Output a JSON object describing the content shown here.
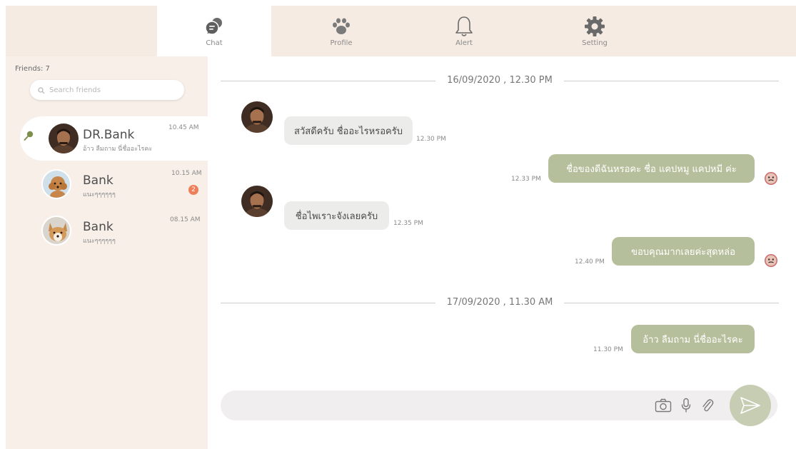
{
  "nav": {
    "tabs": [
      {
        "label": "Chat",
        "icon": "chat-bubbles-icon",
        "active": true
      },
      {
        "label": "Profile",
        "icon": "paw-icon",
        "active": false
      },
      {
        "label": "Alert",
        "icon": "bell-icon",
        "active": false
      },
      {
        "label": "Setting",
        "icon": "gear-icon",
        "active": false
      }
    ]
  },
  "sidebar": {
    "friends_label": "Friends: 7",
    "search_placeholder": "Search friends",
    "friends": [
      {
        "name": "DR.Bank",
        "preview": "อ้าว ลืมถาม นี่ชื่ออะไรคะ",
        "time": "10.45 AM",
        "active": true,
        "pinned": true,
        "avatar": "man-avatar"
      },
      {
        "name": "Bank",
        "preview": "แนะๆๆๆๆๆๆ",
        "time": "10.15 AM",
        "unread": "2",
        "avatar": "poodle-avatar"
      },
      {
        "name": "Bank",
        "preview": "แนะๆๆๆๆๆๆ",
        "time": "08.15 AM",
        "avatar": "corgi-avatar"
      }
    ]
  },
  "chat": {
    "dividers": [
      "16/09/2020 , 12.30 PM",
      "17/09/2020 , 11.30 AM"
    ],
    "messages": [
      {
        "dir": "in",
        "text": "สวัสดีครับ ชื่ออะไรหรอครับ",
        "time": "12.30 PM"
      },
      {
        "dir": "out",
        "text": "ชื่อของดีฉันหรอคะ  ชื่อ แคปหมู แคปหมี ค่ะ",
        "time": "12.33 PM"
      },
      {
        "dir": "in",
        "text": "ชื่อไพเราะจังเลยครับ",
        "time": "12.35 PM"
      },
      {
        "dir": "out",
        "text": "ขอบคุณมากเลยค่ะสุดหล่อ",
        "time": "12.40 PM"
      },
      {
        "dir": "out",
        "text": "อ้าว ลืมถาม นี่ชื่ออะไรคะ",
        "time": "11.30 PM"
      }
    ],
    "composer": {
      "placeholder": "",
      "icons": [
        "camera-icon",
        "microphone-icon",
        "paperclip-icon",
        "send-icon"
      ]
    }
  },
  "colors": {
    "topbar_bg": "#f5ebe3",
    "sidebar_bg": "#f7efe8",
    "bubble_out": "#b6bf9b",
    "bubble_in": "#ececea",
    "send_button": "#c7cdb2",
    "badge": "#ee7f5a",
    "pin": "#7f8f4e"
  }
}
